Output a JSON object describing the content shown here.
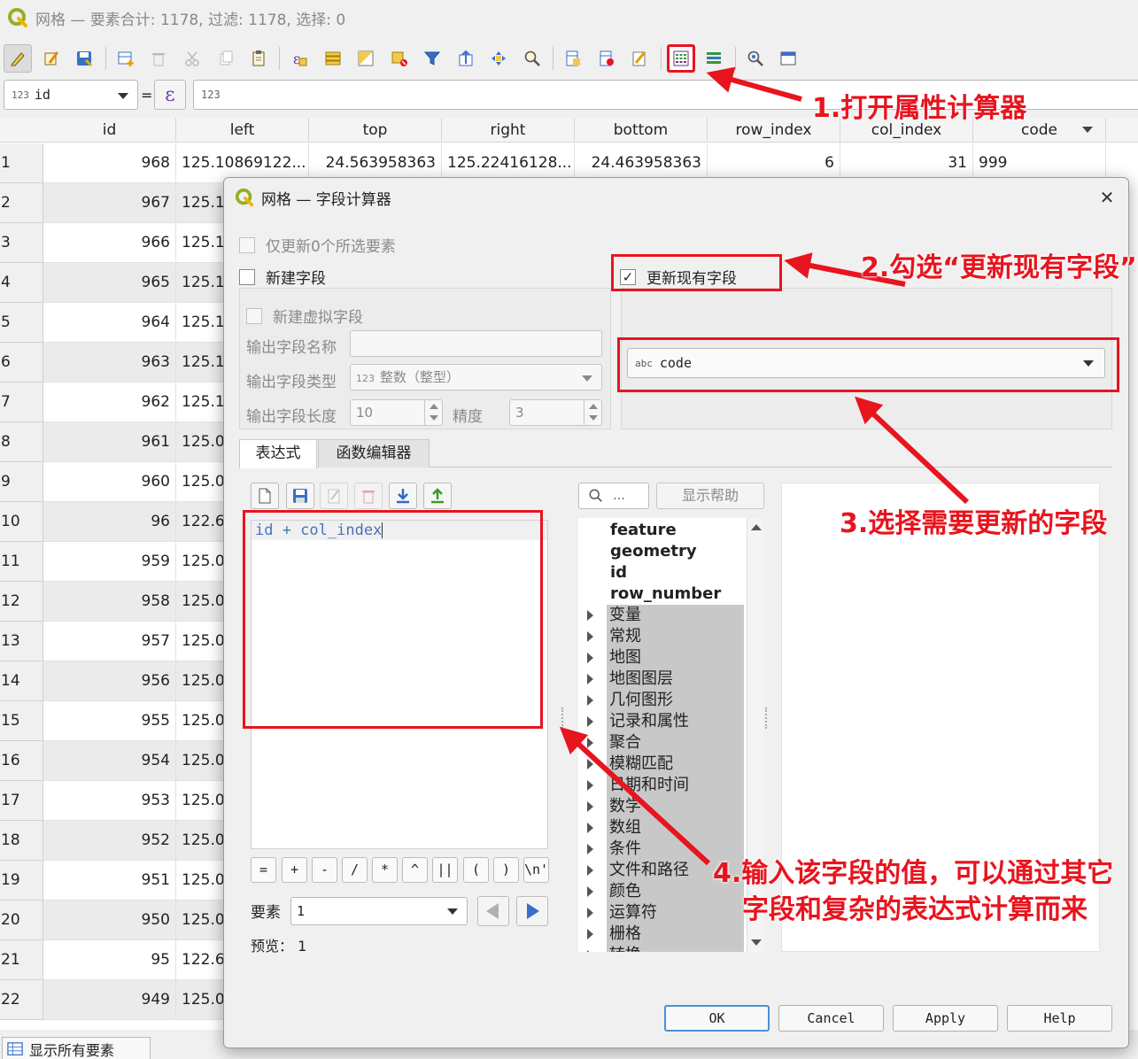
{
  "window": {
    "title": "网格 — 要素合计: 1178, 过滤: 1178, 选择: 0"
  },
  "toolbar": {
    "buttons": [
      {
        "icon": "pencil-edit-icon"
      },
      {
        "icon": "multi-edit-icon"
      },
      {
        "icon": "save-edits-icon"
      },
      {
        "icon": "add-feature-icon"
      },
      {
        "icon": "delete-feature-icon"
      },
      {
        "icon": "cut-icon"
      },
      {
        "icon": "copy-icon"
      },
      {
        "icon": "paste-icon"
      },
      {
        "icon": "select-by-expression-icon"
      },
      {
        "icon": "select-all-icon"
      },
      {
        "icon": "invert-selection-icon"
      },
      {
        "icon": "deselect-icon"
      },
      {
        "icon": "filter-icon"
      },
      {
        "icon": "move-selection-top-icon"
      },
      {
        "icon": "pan-to-selection-icon"
      },
      {
        "icon": "zoom-to-selection-icon"
      },
      {
        "icon": "new-field-icon"
      },
      {
        "icon": "delete-field-icon"
      },
      {
        "icon": "conditional-format-icon"
      },
      {
        "icon": "field-calculator-icon"
      },
      {
        "icon": "organize-columns-icon"
      },
      {
        "icon": "actions-icon"
      },
      {
        "icon": "dock-icon"
      }
    ]
  },
  "filterbar": {
    "field_type_tag": "123",
    "field_name": "id",
    "equals": "=",
    "expression_symbol": "ε",
    "value_type_tag": "123"
  },
  "table": {
    "columns": [
      "id",
      "left",
      "top",
      "right",
      "bottom",
      "row_index",
      "col_index",
      "code"
    ],
    "first_row": {
      "num": "1",
      "id": "968",
      "left": "125.10869122...",
      "top": "24.563958363",
      "right": "125.22416128...",
      "bottom": "24.463958363",
      "row_index": "6",
      "col_index": "31",
      "code": "999"
    },
    "rows": [
      {
        "num": "2",
        "id": "967",
        "left": "125.1"
      },
      {
        "num": "3",
        "id": "966",
        "left": "125.1"
      },
      {
        "num": "4",
        "id": "965",
        "left": "125.1"
      },
      {
        "num": "5",
        "id": "964",
        "left": "125.1"
      },
      {
        "num": "6",
        "id": "963",
        "left": "125.1"
      },
      {
        "num": "7",
        "id": "962",
        "left": "125.1"
      },
      {
        "num": "8",
        "id": "961",
        "left": "125.0"
      },
      {
        "num": "9",
        "id": "960",
        "left": "125.0"
      },
      {
        "num": "10",
        "id": "96",
        "left": "122.6"
      },
      {
        "num": "11",
        "id": "959",
        "left": "125.0"
      },
      {
        "num": "12",
        "id": "958",
        "left": "125.0"
      },
      {
        "num": "13",
        "id": "957",
        "left": "125.0"
      },
      {
        "num": "14",
        "id": "956",
        "left": "125.0"
      },
      {
        "num": "15",
        "id": "955",
        "left": "125.0"
      },
      {
        "num": "16",
        "id": "954",
        "left": "125.0"
      },
      {
        "num": "17",
        "id": "953",
        "left": "125.0"
      },
      {
        "num": "18",
        "id": "952",
        "left": "125.0"
      },
      {
        "num": "19",
        "id": "951",
        "left": "125.0"
      },
      {
        "num": "20",
        "id": "950",
        "left": "125.0"
      },
      {
        "num": "21",
        "id": "95",
        "left": "122.6"
      },
      {
        "num": "22",
        "id": "949",
        "left": "125.0"
      }
    ]
  },
  "statusbar": {
    "show_all": "显示所有要素"
  },
  "dialog": {
    "title": "网格 — 字段计算器",
    "only_selected": "仅更新0个所选要素",
    "new_field": "新建字段",
    "update_existing": "更新现有字段",
    "update_existing_checked": true,
    "virtual_field": "新建虚拟字段",
    "out_name_label": "输出字段名称",
    "out_type_label": "输出字段类型",
    "out_type_tag": "123",
    "out_type_value": "整数（整型）",
    "out_len_label": "输出字段长度",
    "out_len_value": "10",
    "precision_label": "精度",
    "precision_value": "3",
    "existing_field_tag": "abc",
    "existing_field": "code",
    "tabs": [
      "表达式",
      "函数编辑器"
    ],
    "expression": "id + col_index",
    "operators": [
      "=",
      "+",
      "-",
      "/",
      "*",
      "^",
      "||",
      "(",
      ")",
      "\\n'"
    ],
    "search_placeholder": "…",
    "show_help": "显示帮助",
    "func_bold": [
      "feature",
      "geometry",
      "id",
      "row_number"
    ],
    "func_groups": [
      "变量",
      "常规",
      "地图",
      "地图图层",
      "几何图形",
      "记录和属性",
      "聚合",
      "模糊匹配",
      "日期和时间",
      "数学",
      "数组",
      "条件",
      "文件和路径",
      "颜色",
      "运算符",
      "栅格",
      "转换"
    ],
    "feature_label": "要素",
    "feature_value": "1",
    "preview_label": "预览：",
    "preview_value": "1",
    "buttons": {
      "ok": "OK",
      "cancel": "Cancel",
      "apply": "Apply",
      "help": "Help"
    }
  },
  "annotations": {
    "step1": "1.打开属性计算器",
    "step2": "2.勾选“更新现有字段”",
    "step3": "3.选择需要更新的字段",
    "step4_line1": "4.输入该字段的值，可以通过其它",
    "step4_line2": "字段和复杂的表达式计算而来",
    "color": "#e8141e"
  }
}
